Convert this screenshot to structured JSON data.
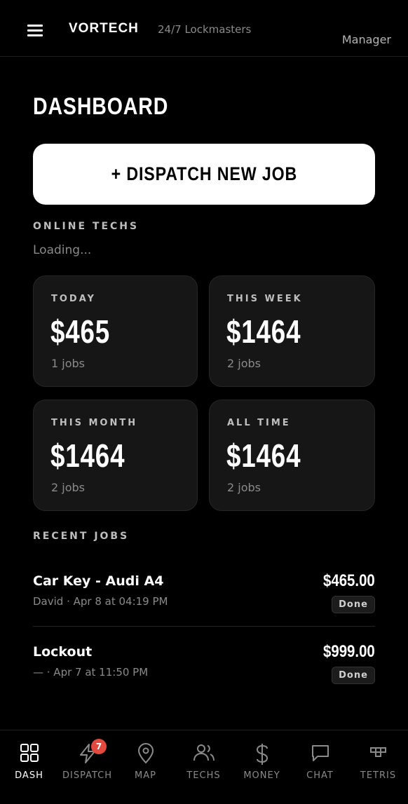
{
  "header": {
    "brand": "VORTECH",
    "tagline": "24/7 Lockmasters",
    "role": "Manager"
  },
  "page": {
    "title": "DASHBOARD",
    "dispatch_button": "+ DISPATCH NEW JOB"
  },
  "online_techs": {
    "label": "ONLINE TECHS",
    "status": "Loading..."
  },
  "stats": [
    {
      "label": "TODAY",
      "amount": "$465",
      "jobs": "1 jobs"
    },
    {
      "label": "THIS WEEK",
      "amount": "$1464",
      "jobs": "2 jobs"
    },
    {
      "label": "THIS MONTH",
      "amount": "$1464",
      "jobs": "2 jobs"
    },
    {
      "label": "ALL TIME",
      "amount": "$1464",
      "jobs": "2 jobs"
    }
  ],
  "recent_jobs": {
    "label": "RECENT JOBS",
    "items": [
      {
        "title": "Car Key - Audi A4",
        "meta": "David · Apr 8 at 04:19 PM",
        "price": "$465.00",
        "status": "Done"
      },
      {
        "title": "Lockout",
        "meta": "— · Apr 7 at 11:50 PM",
        "price": "$999.00",
        "status": "Done"
      }
    ]
  },
  "nav": {
    "items": [
      {
        "label": "DASH",
        "icon": "grid-icon",
        "active": true
      },
      {
        "label": "DISPATCH",
        "icon": "lightning-icon",
        "badge": "7"
      },
      {
        "label": "MAP",
        "icon": "map-pin-icon"
      },
      {
        "label": "TECHS",
        "icon": "users-icon"
      },
      {
        "label": "MONEY",
        "icon": "dollar-icon"
      },
      {
        "label": "CHAT",
        "icon": "chat-icon"
      },
      {
        "label": "TETRIS",
        "icon": "tetris-icon"
      }
    ]
  },
  "colors": {
    "background": "#000000",
    "card": "#161616",
    "accent_badge": "#e34a3f",
    "muted_text": "#8a8a8a"
  }
}
